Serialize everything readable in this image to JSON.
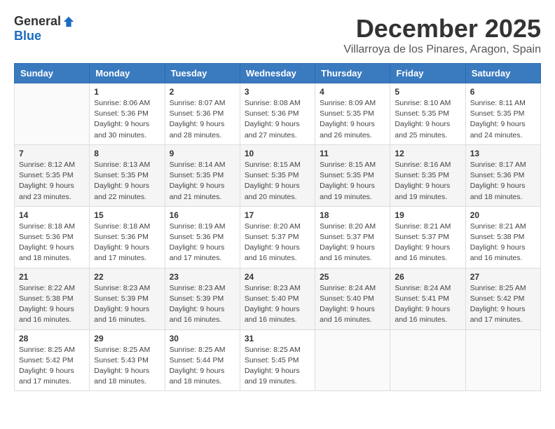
{
  "header": {
    "logo_general": "General",
    "logo_blue": "Blue",
    "month": "December 2025",
    "location": "Villarroya de los Pinares, Aragon, Spain"
  },
  "weekdays": [
    "Sunday",
    "Monday",
    "Tuesday",
    "Wednesday",
    "Thursday",
    "Friday",
    "Saturday"
  ],
  "weeks": [
    [
      {
        "day": "",
        "info": ""
      },
      {
        "day": "1",
        "info": "Sunrise: 8:06 AM\nSunset: 5:36 PM\nDaylight: 9 hours\nand 30 minutes."
      },
      {
        "day": "2",
        "info": "Sunrise: 8:07 AM\nSunset: 5:36 PM\nDaylight: 9 hours\nand 28 minutes."
      },
      {
        "day": "3",
        "info": "Sunrise: 8:08 AM\nSunset: 5:36 PM\nDaylight: 9 hours\nand 27 minutes."
      },
      {
        "day": "4",
        "info": "Sunrise: 8:09 AM\nSunset: 5:35 PM\nDaylight: 9 hours\nand 26 minutes."
      },
      {
        "day": "5",
        "info": "Sunrise: 8:10 AM\nSunset: 5:35 PM\nDaylight: 9 hours\nand 25 minutes."
      },
      {
        "day": "6",
        "info": "Sunrise: 8:11 AM\nSunset: 5:35 PM\nDaylight: 9 hours\nand 24 minutes."
      }
    ],
    [
      {
        "day": "7",
        "info": "Sunrise: 8:12 AM\nSunset: 5:35 PM\nDaylight: 9 hours\nand 23 minutes."
      },
      {
        "day": "8",
        "info": "Sunrise: 8:13 AM\nSunset: 5:35 PM\nDaylight: 9 hours\nand 22 minutes."
      },
      {
        "day": "9",
        "info": "Sunrise: 8:14 AM\nSunset: 5:35 PM\nDaylight: 9 hours\nand 21 minutes."
      },
      {
        "day": "10",
        "info": "Sunrise: 8:15 AM\nSunset: 5:35 PM\nDaylight: 9 hours\nand 20 minutes."
      },
      {
        "day": "11",
        "info": "Sunrise: 8:15 AM\nSunset: 5:35 PM\nDaylight: 9 hours\nand 19 minutes."
      },
      {
        "day": "12",
        "info": "Sunrise: 8:16 AM\nSunset: 5:35 PM\nDaylight: 9 hours\nand 19 minutes."
      },
      {
        "day": "13",
        "info": "Sunrise: 8:17 AM\nSunset: 5:36 PM\nDaylight: 9 hours\nand 18 minutes."
      }
    ],
    [
      {
        "day": "14",
        "info": "Sunrise: 8:18 AM\nSunset: 5:36 PM\nDaylight: 9 hours\nand 18 minutes."
      },
      {
        "day": "15",
        "info": "Sunrise: 8:18 AM\nSunset: 5:36 PM\nDaylight: 9 hours\nand 17 minutes."
      },
      {
        "day": "16",
        "info": "Sunrise: 8:19 AM\nSunset: 5:36 PM\nDaylight: 9 hours\nand 17 minutes."
      },
      {
        "day": "17",
        "info": "Sunrise: 8:20 AM\nSunset: 5:37 PM\nDaylight: 9 hours\nand 16 minutes."
      },
      {
        "day": "18",
        "info": "Sunrise: 8:20 AM\nSunset: 5:37 PM\nDaylight: 9 hours\nand 16 minutes."
      },
      {
        "day": "19",
        "info": "Sunrise: 8:21 AM\nSunset: 5:37 PM\nDaylight: 9 hours\nand 16 minutes."
      },
      {
        "day": "20",
        "info": "Sunrise: 8:21 AM\nSunset: 5:38 PM\nDaylight: 9 hours\nand 16 minutes."
      }
    ],
    [
      {
        "day": "21",
        "info": "Sunrise: 8:22 AM\nSunset: 5:38 PM\nDaylight: 9 hours\nand 16 minutes."
      },
      {
        "day": "22",
        "info": "Sunrise: 8:23 AM\nSunset: 5:39 PM\nDaylight: 9 hours\nand 16 minutes."
      },
      {
        "day": "23",
        "info": "Sunrise: 8:23 AM\nSunset: 5:39 PM\nDaylight: 9 hours\nand 16 minutes."
      },
      {
        "day": "24",
        "info": "Sunrise: 8:23 AM\nSunset: 5:40 PM\nDaylight: 9 hours\nand 16 minutes."
      },
      {
        "day": "25",
        "info": "Sunrise: 8:24 AM\nSunset: 5:40 PM\nDaylight: 9 hours\nand 16 minutes."
      },
      {
        "day": "26",
        "info": "Sunrise: 8:24 AM\nSunset: 5:41 PM\nDaylight: 9 hours\nand 16 minutes."
      },
      {
        "day": "27",
        "info": "Sunrise: 8:25 AM\nSunset: 5:42 PM\nDaylight: 9 hours\nand 17 minutes."
      }
    ],
    [
      {
        "day": "28",
        "info": "Sunrise: 8:25 AM\nSunset: 5:42 PM\nDaylight: 9 hours\nand 17 minutes."
      },
      {
        "day": "29",
        "info": "Sunrise: 8:25 AM\nSunset: 5:43 PM\nDaylight: 9 hours\nand 18 minutes."
      },
      {
        "day": "30",
        "info": "Sunrise: 8:25 AM\nSunset: 5:44 PM\nDaylight: 9 hours\nand 18 minutes."
      },
      {
        "day": "31",
        "info": "Sunrise: 8:25 AM\nSunset: 5:45 PM\nDaylight: 9 hours\nand 19 minutes."
      },
      {
        "day": "",
        "info": ""
      },
      {
        "day": "",
        "info": ""
      },
      {
        "day": "",
        "info": ""
      }
    ]
  ],
  "row_styles": [
    "row-white",
    "row-stripe",
    "row-white",
    "row-stripe",
    "row-white"
  ]
}
